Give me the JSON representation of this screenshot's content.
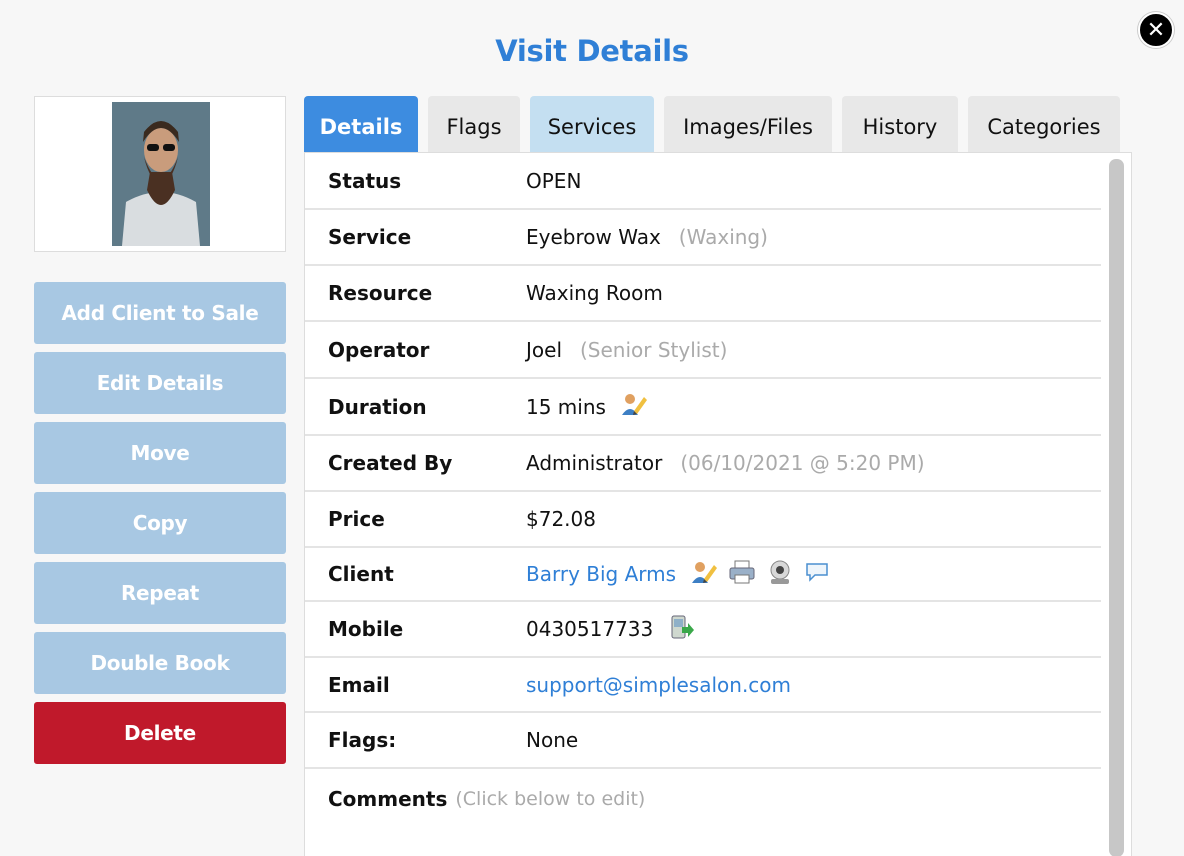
{
  "dialog": {
    "title": "Visit Details",
    "close_icon": "close-icon"
  },
  "sidebar": {
    "buttons": [
      {
        "label": "Add Client to Sale"
      },
      {
        "label": "Edit Details"
      },
      {
        "label": "Move"
      },
      {
        "label": "Copy"
      },
      {
        "label": "Repeat"
      },
      {
        "label": "Double Book"
      },
      {
        "label": "Delete"
      }
    ]
  },
  "tabs": [
    {
      "label": "Details"
    },
    {
      "label": "Flags"
    },
    {
      "label": "Services"
    },
    {
      "label": "Images/Files"
    },
    {
      "label": "History"
    },
    {
      "label": "Categories"
    }
  ],
  "details": {
    "status": {
      "label": "Status",
      "value": "OPEN"
    },
    "service": {
      "label": "Service",
      "value": "Eyebrow Wax",
      "note": "(Waxing)"
    },
    "resource": {
      "label": "Resource",
      "value": "Waxing Room"
    },
    "operator": {
      "label": "Operator",
      "value": "Joel",
      "note": "(Senior Stylist)"
    },
    "duration": {
      "label": "Duration",
      "value": "15 mins"
    },
    "created_by": {
      "label": "Created By",
      "value": "Administrator",
      "note": "(06/10/2021 @ 5:20 PM)"
    },
    "price": {
      "label": "Price",
      "value": "$72.08"
    },
    "client": {
      "label": "Client",
      "value": "Barry Big Arms"
    },
    "mobile": {
      "label": "Mobile",
      "value": "0430517733"
    },
    "email": {
      "label": "Email",
      "value": "support@simplesalon.com"
    },
    "flags": {
      "label": "Flags:",
      "value": "None"
    },
    "comments": {
      "label": "Comments",
      "note": "(Click below to edit)"
    }
  },
  "colors": {
    "accent": "#2f7fd6",
    "button_light": "#a8c8e3",
    "danger": "#c0192b",
    "tab_active": "#3d8ce0",
    "tab_highlight": "#c4dff1"
  }
}
